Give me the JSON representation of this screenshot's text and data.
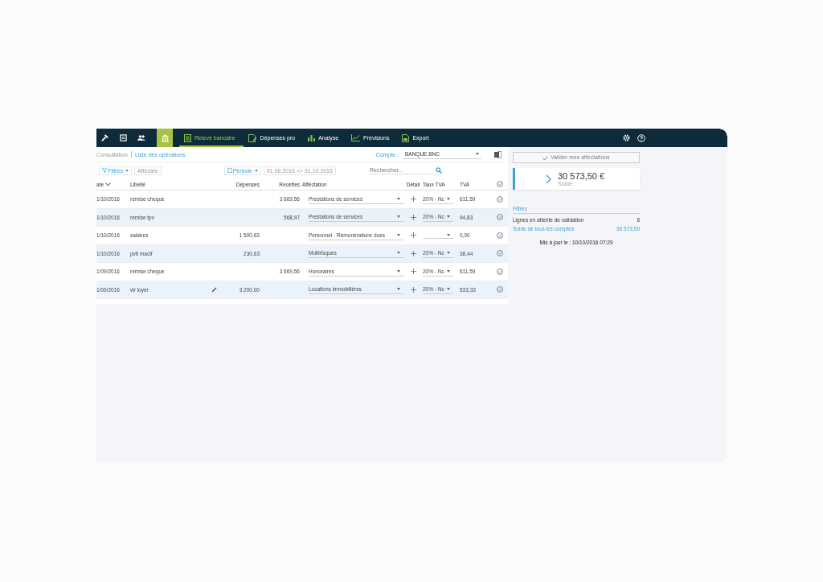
{
  "nav": {
    "icons": [
      {
        "kind": "tool",
        "selected": false
      },
      {
        "kind": "doc",
        "selected": false
      },
      {
        "kind": "people",
        "selected": false
      },
      {
        "kind": "bank",
        "selected": true
      }
    ],
    "items": [
      {
        "label": "Relevé bancaire",
        "kind": "statement",
        "selected": true
      },
      {
        "label": "Dépenses pro",
        "kind": "expense",
        "selected": false
      },
      {
        "label": "Analyse",
        "kind": "bars",
        "selected": false
      },
      {
        "label": "Prévisions",
        "kind": "trend",
        "selected": false
      },
      {
        "label": "Export",
        "kind": "export",
        "selected": false
      }
    ]
  },
  "breadcrumb": {
    "parent": "Consultation",
    "current": "Liste des opérations"
  },
  "account": {
    "label": "Compte :",
    "value": "BANQUE BNC"
  },
  "toolbar": {
    "filters": "Filtres",
    "affected": "Affectée",
    "period": "Période",
    "range": "01.06.2016 <> 31.10.2016",
    "search_placeholder": "Rechercher..."
  },
  "table": {
    "columns": [
      "ate",
      "Libellé",
      "Dépenses",
      "Recettes",
      "Affectation",
      "Détail",
      "Taux TVA",
      "TVA"
    ],
    "rows": [
      {
        "date": "1/10/2016",
        "label": "remise cheque",
        "editable": false,
        "expense": "",
        "income": "3 669,56",
        "category": "Prestations de services",
        "rate": "20% - Nc",
        "vat": "611,59"
      },
      {
        "date": "1/10/2016",
        "label": "remise tpv",
        "editable": false,
        "expense": "",
        "income": "568,97",
        "category": "Prestations de services",
        "rate": "20% - Nc",
        "vat": "94,83"
      },
      {
        "date": "1/10/2016",
        "label": "salaires",
        "editable": false,
        "expense": "1 500,63",
        "income": "",
        "category": "Personnel - Rémunérations dues",
        "rate": "",
        "vat": "0,00"
      },
      {
        "date": "1/10/2016",
        "label": "pvlt macif",
        "editable": false,
        "expense": "230,63",
        "income": "",
        "category": "Multirisques",
        "rate": "20% - Nc",
        "vat": "38,44"
      },
      {
        "date": "1/09/2016",
        "label": "remise cheque",
        "editable": false,
        "expense": "",
        "income": "3 669,56",
        "category": "Honoraires",
        "rate": "20% - Nc",
        "vat": "611,59"
      },
      {
        "date": "1/09/2016",
        "label": "vir loyer",
        "editable": true,
        "expense": "3 200,00",
        "income": "",
        "category": "Locations immobilières",
        "rate": "20% - Nc",
        "vat": "533,33"
      }
    ]
  },
  "side": {
    "validate": "Valider mes affectations",
    "balance": "30 573,50",
    "currency": "€",
    "balance_label": "Solde",
    "filters_title": "Filtres",
    "filters": [
      {
        "label": "Lignes en attente de validation",
        "value": "6",
        "kind": "plain"
      },
      {
        "label": "Solde de tous les comptes",
        "value": "30 573,50",
        "kind": "link"
      }
    ],
    "updated": "Mis à jour le : 10/10/2016 07:29"
  }
}
